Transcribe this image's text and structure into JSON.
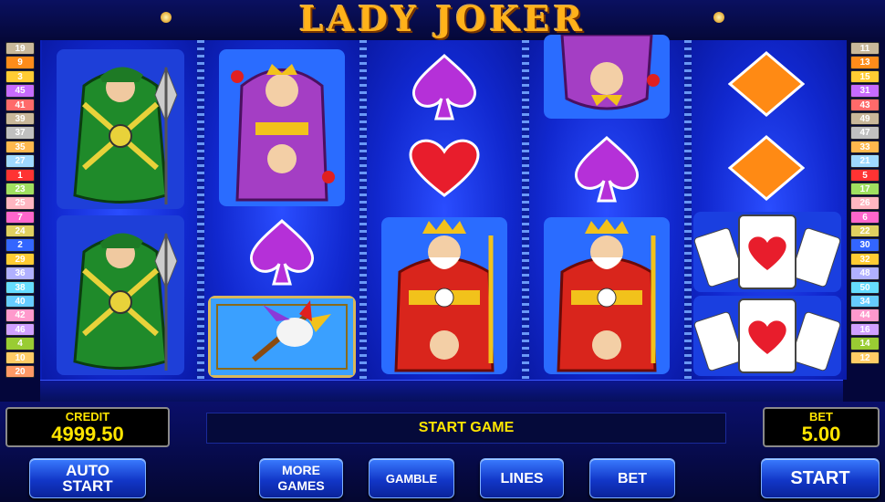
{
  "game": {
    "title": "LADY JOKER"
  },
  "paylines": {
    "left": [
      "19",
      "9",
      "3",
      "45",
      "41",
      "39",
      "37",
      "35",
      "27",
      "1",
      "23",
      "25",
      "7",
      "24",
      "2",
      "29",
      "36",
      "38",
      "40",
      "42",
      "46",
      "4",
      "10",
      "20"
    ],
    "right": [
      "11",
      "13",
      "15",
      "31",
      "43",
      "49",
      "47",
      "33",
      "21",
      "5",
      "17",
      "26",
      "6",
      "22",
      "30",
      "32",
      "48",
      "50",
      "34",
      "44",
      "16",
      "14",
      "12"
    ],
    "colors": [
      "#c9b89a",
      "#ff8c1a",
      "#ffcc33",
      "#c76bff",
      "#ff6a6a",
      "#c9b89a",
      "#c0c0c0",
      "#ffb84d",
      "#9fd9ff",
      "#ff3333",
      "#a0e060",
      "#ffb6c1",
      "#ff66cc",
      "#e0d060",
      "#3366ff",
      "#ffcc33",
      "#b0b0ff",
      "#66ddff",
      "#66ccff",
      "#ff99cc",
      "#d0a0ff",
      "#99cc33",
      "#ffcc66",
      "#ff9966"
    ]
  },
  "reels": [
    [
      "jack",
      "jack"
    ],
    [
      "queen",
      "spade",
      "joker-jester"
    ],
    [
      "spade",
      "heart",
      "king"
    ],
    [
      "queen",
      "spade",
      "king"
    ],
    [
      "diamond",
      "diamond",
      "ace-fan",
      "ace-fan"
    ]
  ],
  "panel": {
    "credit_label": "CREDIT",
    "credit_value": "4999.50",
    "message": "START GAME",
    "bet_label": "BET",
    "bet_value": "5.00"
  },
  "buttons": {
    "auto_start": "AUTO\nSTART",
    "more_games": "MORE\nGAMES",
    "gamble": "GAMBLE",
    "lines": "LINES",
    "bet": "BET",
    "start": "START"
  },
  "colors": {
    "accent": "#ffe500",
    "reel_bg": "#1733e0",
    "title": "#ffb21a"
  }
}
